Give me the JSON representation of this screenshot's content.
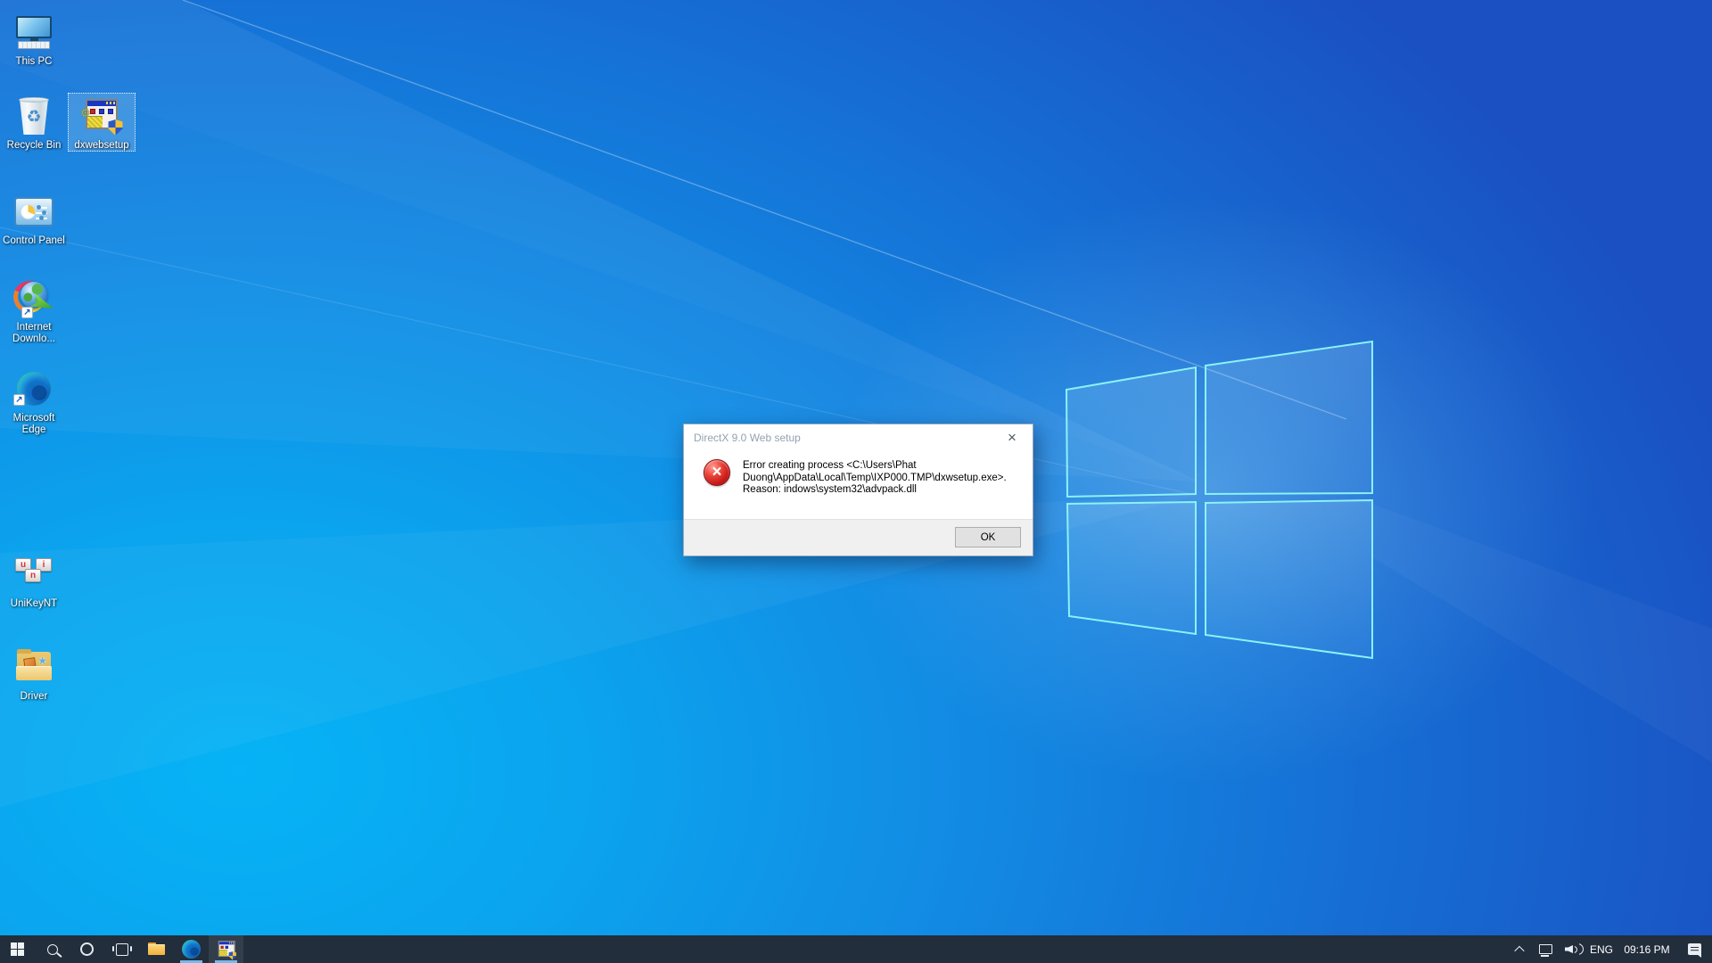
{
  "colors": {
    "wallpaper_bright": "#06b3f5",
    "wallpaper_deep": "#1a50c2",
    "logo_edge": "#8af2f8",
    "taskbar_bg": "#222e3c",
    "running_indicator": "#76b9ed",
    "error_red": "#c01616",
    "selection_blue": "rgba(110,175,230,0.45)"
  },
  "glyphs": {
    "recycle": "♻",
    "gear": "⚙",
    "shortcut_arrow": "↗",
    "star": "★",
    "close": "×",
    "error_x": "×"
  },
  "desktop": {
    "icons": [
      {
        "name": "this-pc",
        "label": "This PC",
        "selected": false
      },
      {
        "name": "recycle-bin",
        "label": "Recycle Bin",
        "selected": false
      },
      {
        "name": "dxwebsetup",
        "label": "dxwebsetup",
        "selected": true
      },
      {
        "name": "control-panel",
        "label": "Control Panel",
        "selected": false
      },
      {
        "name": "internet-download-manager",
        "label": "Internet Downlo...",
        "selected": false
      },
      {
        "name": "microsoft-edge",
        "label": "Microsoft Edge",
        "selected": false
      },
      {
        "name": "unikey-nt",
        "label": "UniKeyNT",
        "selected": false
      },
      {
        "name": "driver",
        "label": "Driver",
        "selected": false
      }
    ],
    "unikey_letters": {
      "k1": "u",
      "k2": "i",
      "k3": "n"
    }
  },
  "dialog": {
    "title": "DirectX 9.0 Web setup",
    "message_lines": [
      "Error creating process <C:\\Users\\Phat",
      "Duong\\AppData\\Local\\Temp\\IXP000.TMP\\dxwsetup.exe>.",
      "Reason: indows\\system32\\advpack.dll"
    ],
    "ok_label": "OK"
  },
  "taskbar": {
    "buttons": [
      {
        "name": "start",
        "icon": "windows-logo-icon"
      },
      {
        "name": "search",
        "icon": "search-icon"
      },
      {
        "name": "cortana",
        "icon": "cortana-ring-icon"
      },
      {
        "name": "task-view",
        "icon": "task-view-icon"
      },
      {
        "name": "file-explorer",
        "icon": "folder-icon"
      },
      {
        "name": "microsoft-edge",
        "icon": "edge-icon",
        "running": true
      },
      {
        "name": "dxwebsetup",
        "icon": "installer-icon",
        "running": true,
        "active": true
      }
    ],
    "tray": {
      "language": "ENG",
      "time": "09:16 PM"
    }
  }
}
